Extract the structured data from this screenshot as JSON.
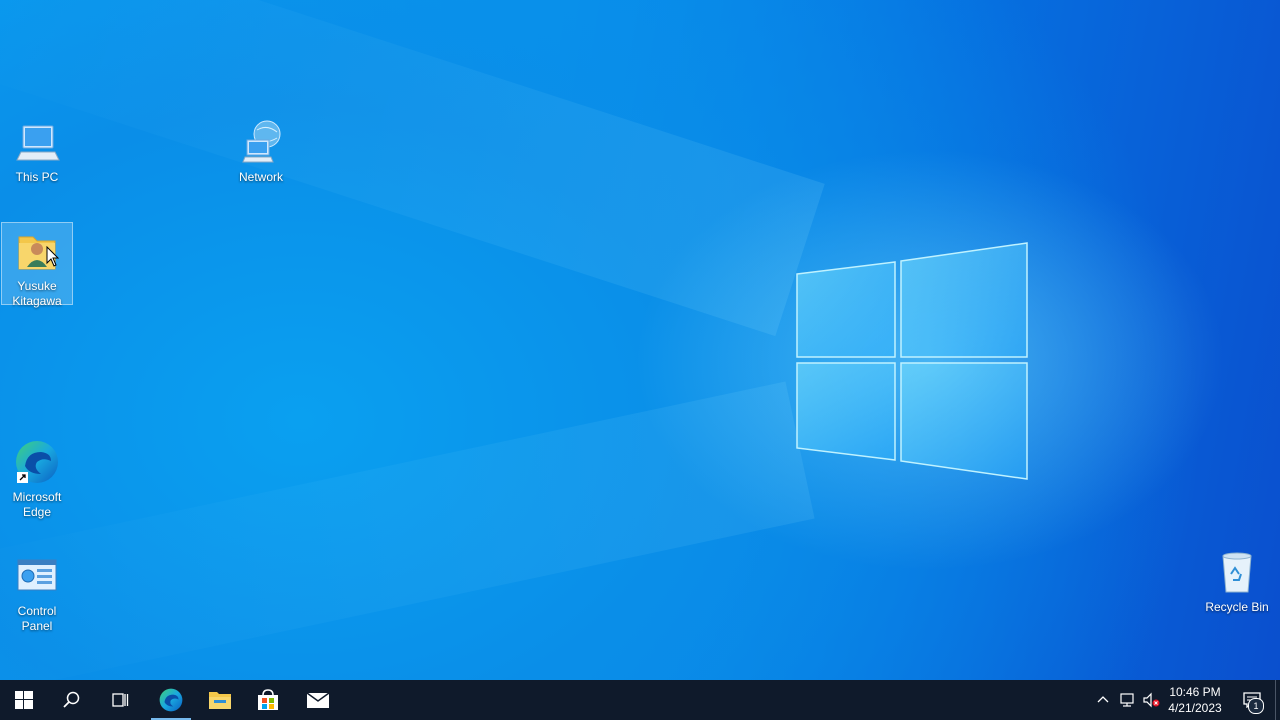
{
  "desktop": {
    "icons": [
      {
        "label": "This PC",
        "icon": "computer-icon"
      },
      {
        "label": "Network",
        "icon": "network-icon"
      },
      {
        "label": "Yusuke Kitagawa",
        "icon": "user-folder-icon",
        "selected": true
      },
      {
        "label": "Microsoft Edge",
        "icon": "edge-icon",
        "shortcut": true
      },
      {
        "label": "Control Panel",
        "icon": "control-panel-icon"
      },
      {
        "label": "Recycle Bin",
        "icon": "recycle-bin-icon"
      }
    ]
  },
  "taskbar": {
    "buttons": [
      {
        "name": "start",
        "icon": "windows-start-icon"
      },
      {
        "name": "search",
        "icon": "search-icon"
      },
      {
        "name": "task-view",
        "icon": "task-view-icon"
      },
      {
        "name": "edge",
        "icon": "edge-icon",
        "active": true
      },
      {
        "name": "file-explorer",
        "icon": "folder-icon"
      },
      {
        "name": "microsoft-store",
        "icon": "store-icon"
      },
      {
        "name": "mail",
        "icon": "mail-icon"
      }
    ],
    "tray": {
      "icons": [
        "chevron-up-icon",
        "network-status-icon",
        "volume-muted-icon"
      ],
      "time": "10:46 PM",
      "date": "4/21/2023",
      "notification_count": "1"
    }
  },
  "colors": {
    "taskbar": "#0f1a2b",
    "accent": "#76b9ed",
    "wallpaper": "#0a8ee8"
  }
}
